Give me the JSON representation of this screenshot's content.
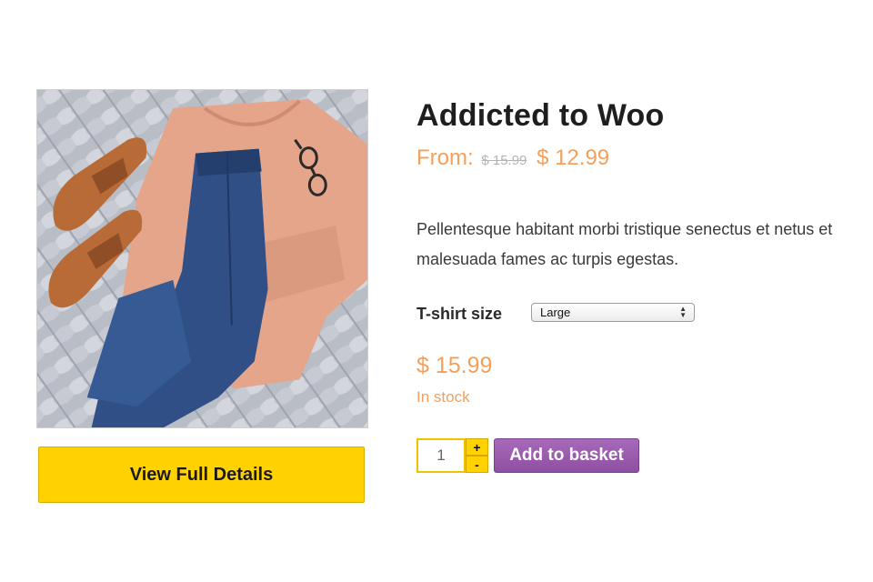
{
  "product": {
    "title": "Addicted to Woo",
    "price_from_label": "From:",
    "price_old": "$ 15.99",
    "price_new": "$ 12.99",
    "description": "Pellentesque habitant morbi tristique senectus et netus et malesuada fames ac turpis egestas.",
    "image_icon": "product-photo-clothes-flatlay"
  },
  "actions": {
    "view_details_label": "View Full Details",
    "add_to_basket_label": "Add to basket"
  },
  "variation": {
    "size_label": "T-shirt size",
    "size_selected": "Large",
    "price": "$ 15.99",
    "stock_status": "In stock"
  },
  "quantity": {
    "value": "1",
    "plus_label": "+",
    "minus_label": "-"
  },
  "colors": {
    "price_accent": "#f5a05a",
    "primary_button": "#ffd200",
    "basket_button": "#9b5cb0"
  }
}
